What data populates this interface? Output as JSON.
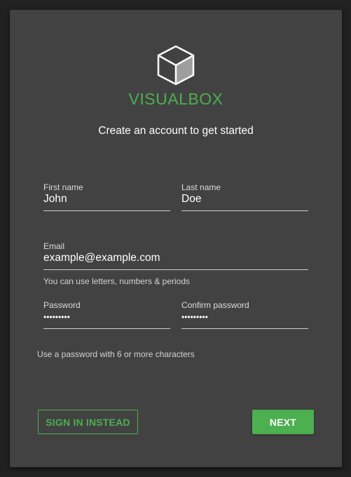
{
  "brand": {
    "name": "VISUALBOX",
    "logo_icon": "cube-icon",
    "accent_color": "#4caf50"
  },
  "form": {
    "subtitle": "Create an account to get started",
    "first_name": {
      "label": "First name",
      "value": "John"
    },
    "last_name": {
      "label": "Last name",
      "value": "Doe"
    },
    "email": {
      "label": "Email",
      "value": "example@example.com",
      "hint": "You can use letters, numbers & periods"
    },
    "password": {
      "label": "Password",
      "value": "•••••••••"
    },
    "confirm_password": {
      "label": "Confirm password",
      "value": "•••••••••"
    },
    "password_hint": "Use a password with 6 or more characters"
  },
  "actions": {
    "sign_in_label": "SIGN IN INSTEAD",
    "next_label": "NEXT"
  }
}
